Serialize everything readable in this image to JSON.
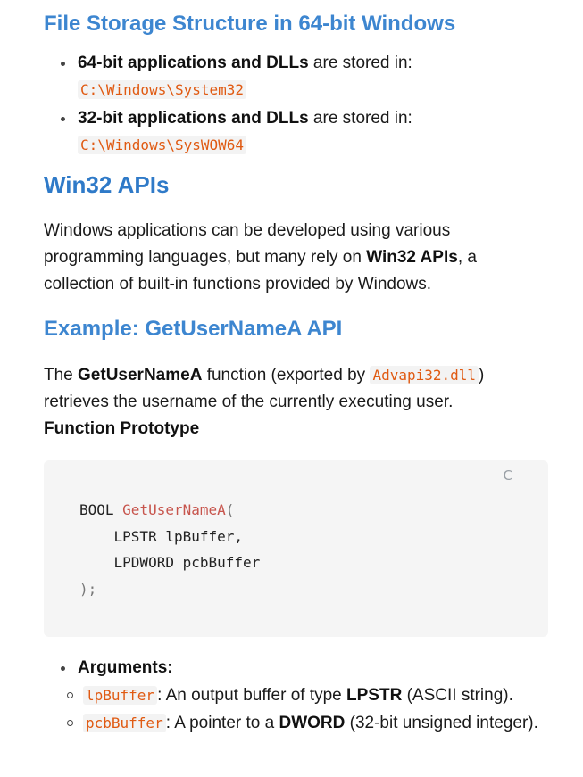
{
  "storage": {
    "heading": "File Storage Structure in 64-bit Windows",
    "items": [
      {
        "bold": "64-bit applications and DLLs",
        "text": " are stored in:",
        "path": "C:\\Windows\\System32"
      },
      {
        "bold": "32-bit applications and DLLs",
        "text": " are stored in:",
        "path": "C:\\Windows\\SysWOW64"
      }
    ]
  },
  "win32": {
    "heading": "Win32 APIs",
    "para_1": "Windows applications can be developed using various programming languages, but many rely on ",
    "para_bold": "Win32 APIs",
    "para_2": ", a collection of built-in functions provided by Windows."
  },
  "example": {
    "heading": "Example: GetUserNameA API",
    "p_the": "The ",
    "p_fn": "GetUserNameA",
    "p_mid": " function (exported by ",
    "p_dll": "Advapi32.dll",
    "p_end": ") retrieves the username of the currently executing user.",
    "prototype_label": "Function Prototype"
  },
  "code": {
    "copy_label": "C",
    "type": "BOOL",
    "fn": "GetUserNameA",
    "open": "(",
    "line2": "    LPSTR lpBuffer,",
    "line3": "    LPDWORD pcbBuffer",
    "close": ");"
  },
  "arguments": {
    "label": "Arguments:",
    "items": [
      {
        "code": "lpBuffer",
        "t1": ": An output buffer of type ",
        "bold": "LPSTR",
        "t2": " (ASCII string)."
      },
      {
        "code": "pcbBuffer",
        "t1": ": A pointer to a ",
        "bold": "DWORD",
        "t2": " (32-bit unsigned integer)."
      }
    ]
  }
}
